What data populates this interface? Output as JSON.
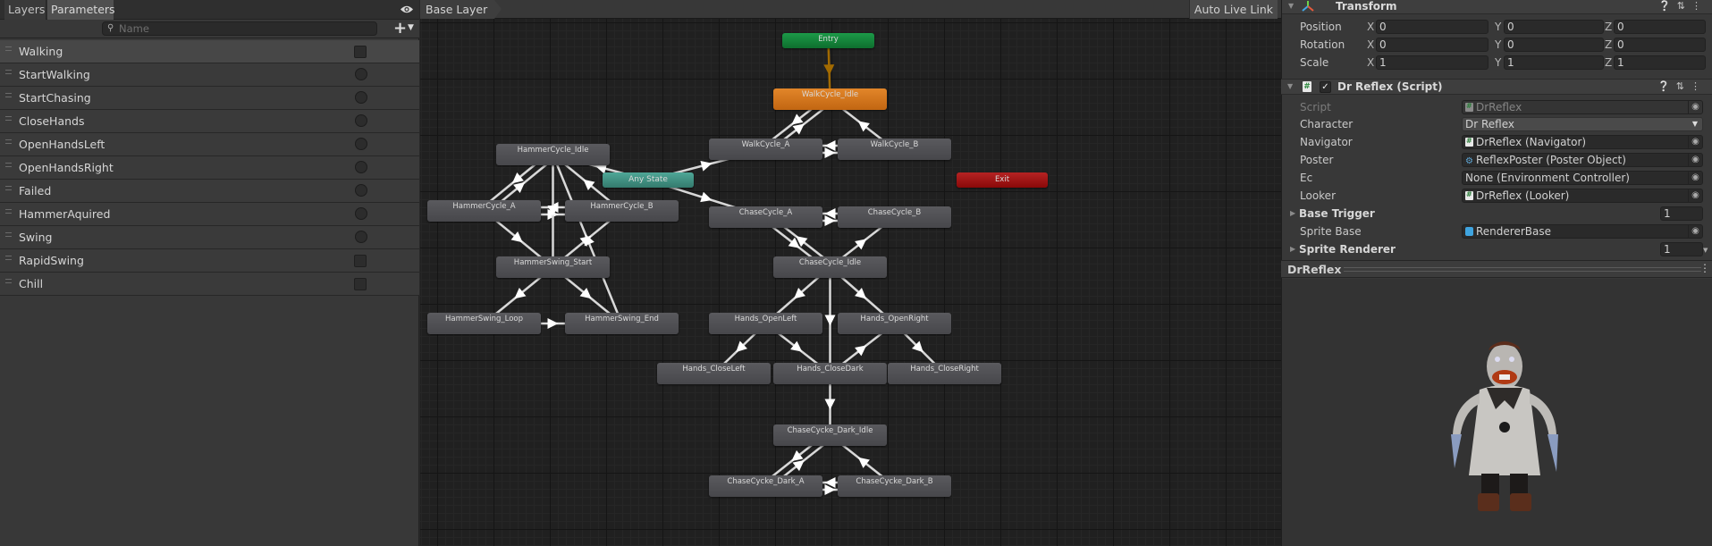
{
  "left_panel": {
    "tabs": [
      {
        "label": "Layers",
        "active": false
      },
      {
        "label": "Parameters",
        "active": true
      }
    ],
    "search": {
      "placeholder": "Name",
      "value": ""
    },
    "add_button": "+",
    "parameters": [
      {
        "name": "Walking",
        "type": "bool",
        "value": false,
        "selected": true
      },
      {
        "name": "StartWalking",
        "type": "trigger",
        "value": false
      },
      {
        "name": "StartChasing",
        "type": "trigger",
        "value": false
      },
      {
        "name": "CloseHands",
        "type": "trigger",
        "value": false
      },
      {
        "name": "OpenHandsLeft",
        "type": "trigger",
        "value": false
      },
      {
        "name": "OpenHandsRight",
        "type": "trigger",
        "value": false
      },
      {
        "name": "Failed",
        "type": "trigger",
        "value": false
      },
      {
        "name": "HammerAquired",
        "type": "trigger",
        "value": false
      },
      {
        "name": "Swing",
        "type": "trigger",
        "value": false
      },
      {
        "name": "RapidSwing",
        "type": "bool",
        "value": false
      },
      {
        "name": "Chill",
        "type": "bool",
        "value": false
      }
    ]
  },
  "graph": {
    "breadcrumb": "Base Layer",
    "auto_live_link": "Auto Live Link",
    "colors": {
      "entry": "#14843c",
      "default_state": "#d67a1e",
      "any_state": "#43907f",
      "exit": "#a11616",
      "state": "#505054",
      "transition": "#d8d8d8",
      "entry_transition": "#a26a00"
    },
    "nodes": [
      {
        "id": "entry",
        "label": "Entry",
        "kind": "entry"
      },
      {
        "id": "walk_idle",
        "label": "WalkCycle_Idle",
        "kind": "default"
      },
      {
        "id": "walk_a",
        "label": "WalkCycle_A",
        "kind": "state"
      },
      {
        "id": "walk_b",
        "label": "WalkCycle_B",
        "kind": "state"
      },
      {
        "id": "any",
        "label": "Any State",
        "kind": "any"
      },
      {
        "id": "exit",
        "label": "Exit",
        "kind": "exit"
      },
      {
        "id": "hammer_idle",
        "label": "HammerCycle_Idle",
        "kind": "state"
      },
      {
        "id": "hammer_a",
        "label": "HammerCycle_A",
        "kind": "state"
      },
      {
        "id": "hammer_b",
        "label": "HammerCycle_B",
        "kind": "state"
      },
      {
        "id": "swing_start",
        "label": "HammerSwing_Start",
        "kind": "state"
      },
      {
        "id": "swing_loop",
        "label": "HammerSwing_Loop",
        "kind": "state"
      },
      {
        "id": "swing_end",
        "label": "HammerSwing_End",
        "kind": "state"
      },
      {
        "id": "chase_a",
        "label": "ChaseCycle_A",
        "kind": "state"
      },
      {
        "id": "chase_b",
        "label": "ChaseCycle_B",
        "kind": "state"
      },
      {
        "id": "chase_idle",
        "label": "ChaseCycle_Idle",
        "kind": "state"
      },
      {
        "id": "open_left",
        "label": "Hands_OpenLeft",
        "kind": "state"
      },
      {
        "id": "open_right",
        "label": "Hands_OpenRight",
        "kind": "state"
      },
      {
        "id": "close_left",
        "label": "Hands_CloseLeft",
        "kind": "state"
      },
      {
        "id": "close_dark",
        "label": "Hands_CloseDark",
        "kind": "state"
      },
      {
        "id": "close_right",
        "label": "Hands_CloseRight",
        "kind": "state"
      },
      {
        "id": "dark_idle",
        "label": "ChaseCycke_Dark_Idle",
        "kind": "state"
      },
      {
        "id": "dark_a",
        "label": "ChaseCycke_Dark_A",
        "kind": "state"
      },
      {
        "id": "dark_b",
        "label": "ChaseCycke_Dark_B",
        "kind": "state"
      }
    ],
    "transitions": [
      [
        "entry",
        "walk_idle"
      ],
      [
        "walk_idle",
        "walk_a"
      ],
      [
        "walk_a",
        "walk_idle"
      ],
      [
        "walk_b",
        "walk_idle"
      ],
      [
        "walk_a",
        "walk_b"
      ],
      [
        "walk_b",
        "walk_a"
      ],
      [
        "any",
        "walk_a"
      ],
      [
        "any",
        "hammer_idle"
      ],
      [
        "any",
        "chase_a"
      ],
      [
        "hammer_idle",
        "hammer_a"
      ],
      [
        "hammer_a",
        "hammer_idle"
      ],
      [
        "hammer_b",
        "hammer_idle"
      ],
      [
        "hammer_a",
        "hammer_b"
      ],
      [
        "hammer_b",
        "hammer_a"
      ],
      [
        "hammer_idle",
        "swing_start"
      ],
      [
        "hammer_a",
        "swing_start"
      ],
      [
        "swing_start",
        "hammer_b"
      ],
      [
        "swing_start",
        "swing_loop"
      ],
      [
        "swing_start",
        "swing_end"
      ],
      [
        "swing_loop",
        "swing_end"
      ],
      [
        "swing_end",
        "hammer_idle"
      ],
      [
        "chase_a",
        "chase_b"
      ],
      [
        "chase_b",
        "chase_a"
      ],
      [
        "chase_idle",
        "chase_a"
      ],
      [
        "chase_a",
        "chase_idle"
      ],
      [
        "chase_idle",
        "chase_b"
      ],
      [
        "chase_idle",
        "open_left"
      ],
      [
        "chase_idle",
        "open_right"
      ],
      [
        "chase_idle",
        "close_dark"
      ],
      [
        "open_left",
        "close_left"
      ],
      [
        "open_left",
        "close_dark"
      ],
      [
        "close_dark",
        "open_right"
      ],
      [
        "open_right",
        "close_right"
      ],
      [
        "close_dark",
        "dark_idle"
      ],
      [
        "dark_idle",
        "dark_a"
      ],
      [
        "dark_a",
        "dark_idle"
      ],
      [
        "dark_b",
        "dark_idle"
      ],
      [
        "dark_a",
        "dark_b"
      ],
      [
        "dark_b",
        "dark_a"
      ]
    ]
  },
  "inspector": {
    "transform": {
      "title": "Transform",
      "rows": [
        {
          "label": "Position",
          "x": "0",
          "y": "0",
          "z": "0"
        },
        {
          "label": "Rotation",
          "x": "0",
          "y": "0",
          "z": "0"
        },
        {
          "label": "Scale",
          "x": "1",
          "y": "1",
          "z": "1"
        }
      ],
      "axis_labels": {
        "x": "X",
        "y": "Y",
        "z": "Z"
      }
    },
    "script": {
      "title": "Dr Reflex (Script)",
      "enabled": true,
      "fields": {
        "script": {
          "label": "Script",
          "value": "DrReflex"
        },
        "character": {
          "label": "Character",
          "value": "Dr Reflex"
        },
        "navigator": {
          "label": "Navigator",
          "value": "DrReflex (Navigator)"
        },
        "poster": {
          "label": "Poster",
          "value": "ReflexPoster (Poster Object)"
        },
        "ec": {
          "label": "Ec",
          "value": "None (Environment Controller)"
        },
        "looker": {
          "label": "Looker",
          "value": "DrReflex (Looker)"
        },
        "base_trigger": {
          "label": "Base Trigger",
          "value": "1"
        },
        "sprite_base": {
          "label": "Sprite Base",
          "value": "RendererBase"
        },
        "sprite_renderer": {
          "label": "Sprite Renderer",
          "value": "1"
        }
      }
    },
    "preview": {
      "title": "DrReflex"
    }
  }
}
